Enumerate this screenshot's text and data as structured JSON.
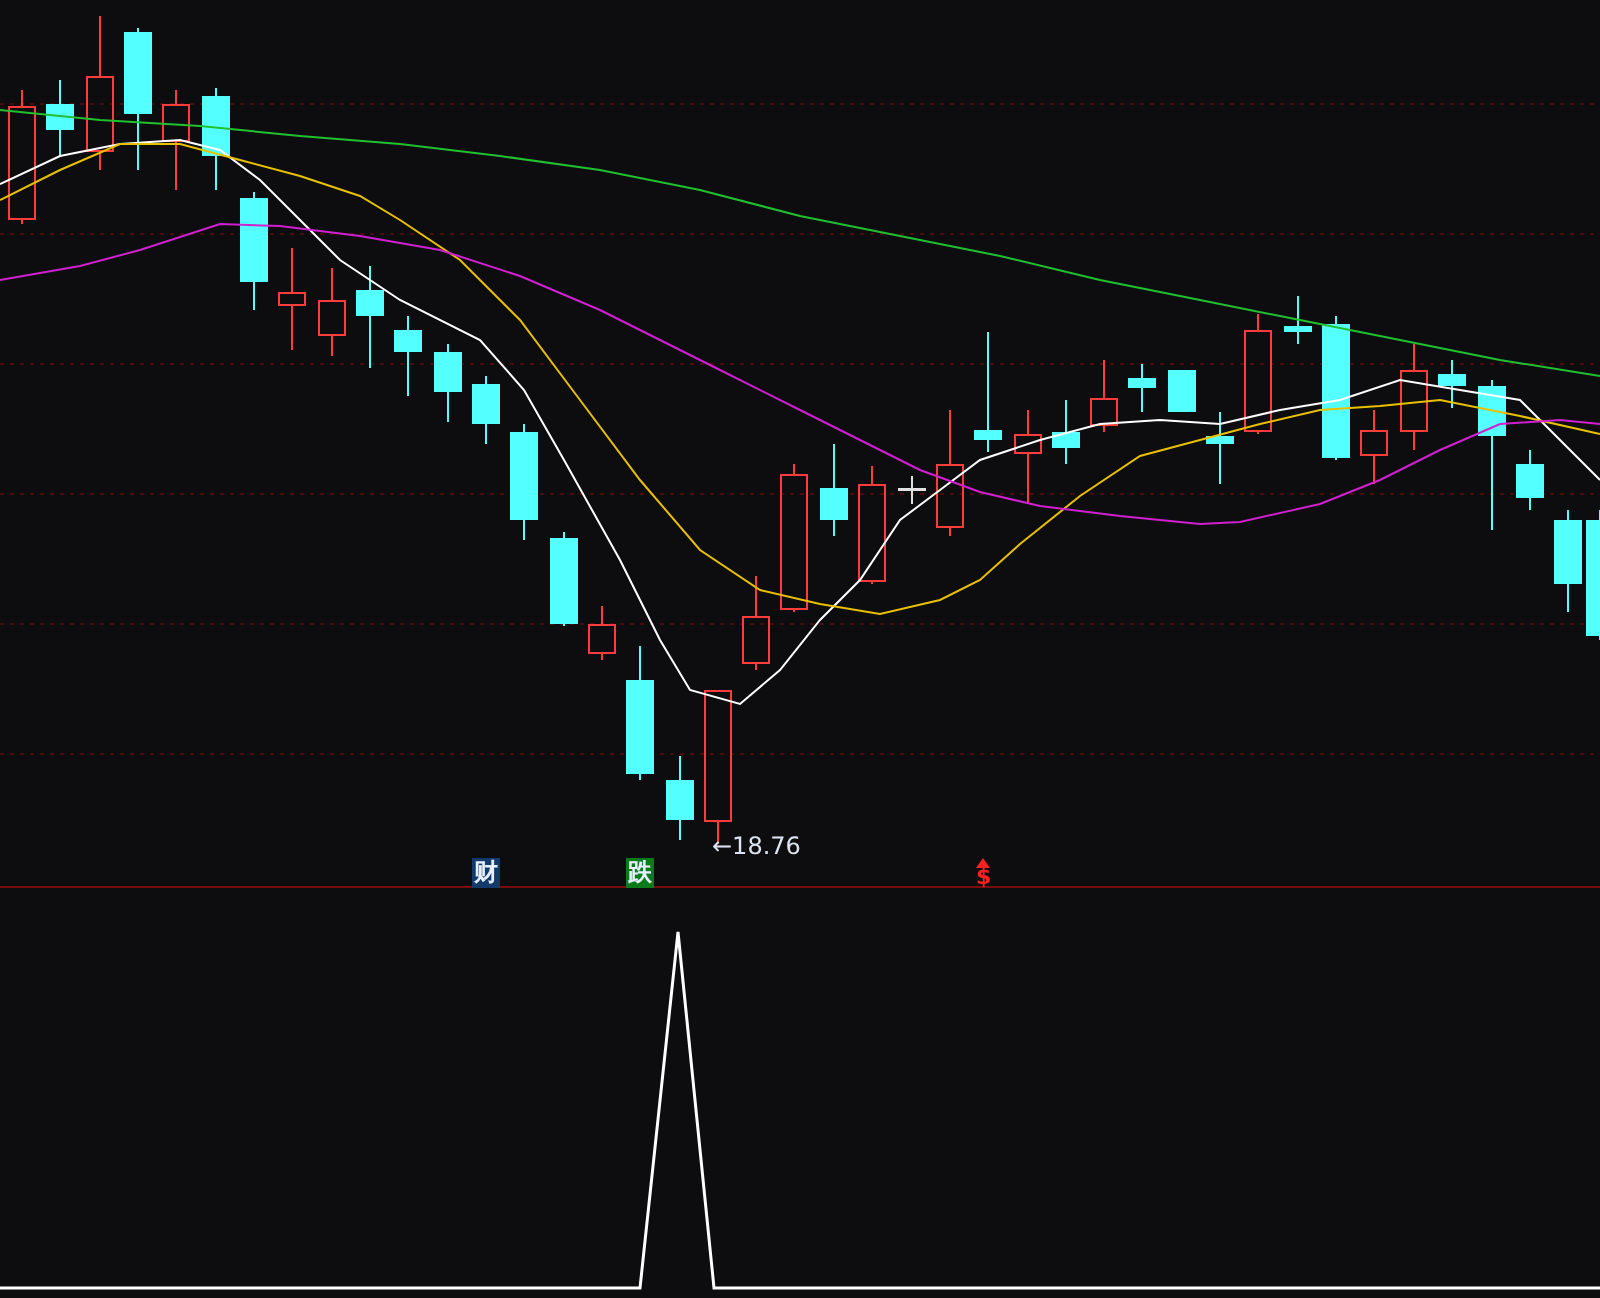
{
  "price_panel": {
    "low_price_label": "←18.76"
  },
  "signal_row": [
    {
      "kind": "tag",
      "text": "财",
      "color": "#123a6b"
    },
    {
      "kind": "tag",
      "text": "跌",
      "color": "#0b7a1a"
    },
    {
      "kind": "buy",
      "text": "$",
      "color": "#ff2020"
    }
  ]
}
